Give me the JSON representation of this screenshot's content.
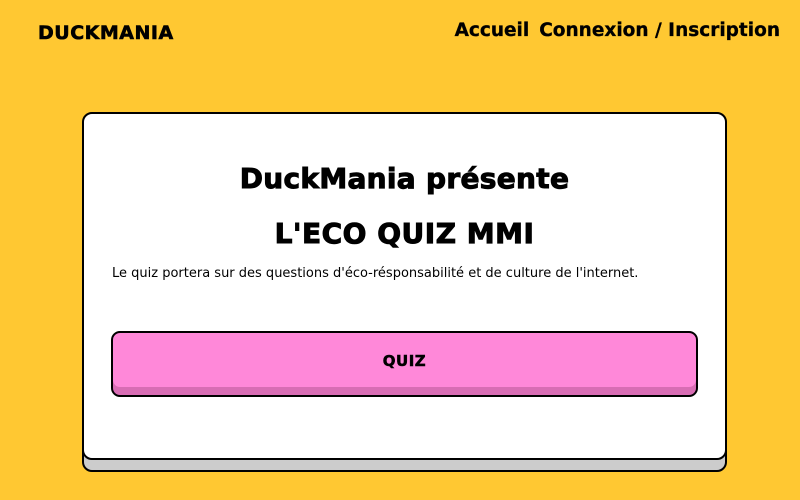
{
  "header": {
    "logo": "DUCKMANIA",
    "nav": {
      "home": "Accueil",
      "login": "Connexion / Inscription"
    }
  },
  "card": {
    "title": "DuckMania présente",
    "subtitle": "L'ECO QUIZ MMI",
    "description": "Le quiz portera sur des questions d'éco-résponsabilité et de culture de l'internet.",
    "button_label": "QUIZ"
  },
  "colors": {
    "background": "#FFC832",
    "button": "#FF88D9",
    "card": "#FFFFFF"
  }
}
